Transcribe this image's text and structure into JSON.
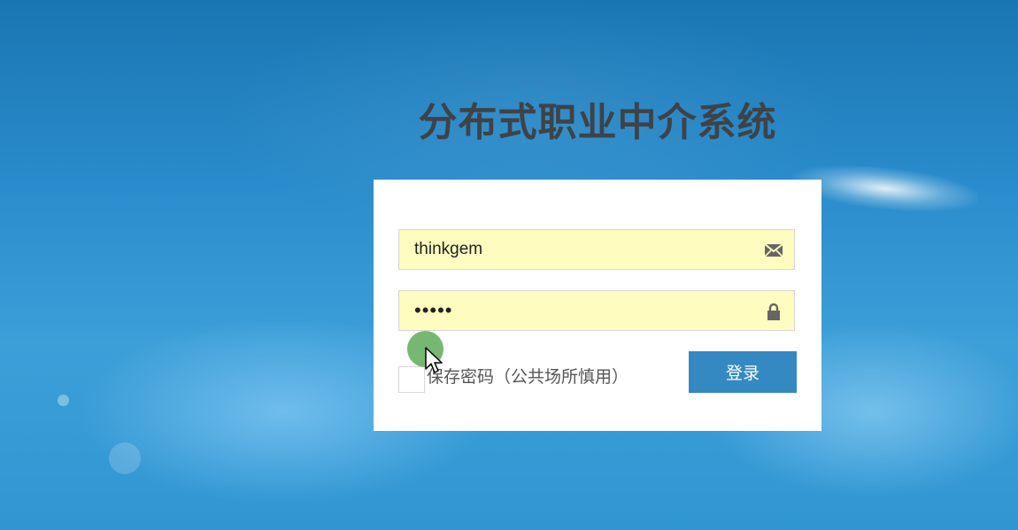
{
  "page": {
    "title": "分布式职业中介系统"
  },
  "login_form": {
    "username": {
      "value": "thinkgem",
      "icon": "envelope-icon"
    },
    "password": {
      "value": "•••••",
      "icon": "lock-icon"
    },
    "remember_label": "保存密码（公共场所慎用）",
    "remember_checked": false,
    "submit_label": "登录"
  },
  "colors": {
    "background": "#2a8ccc",
    "title": "#3f4246",
    "field_background": "#fefcbf",
    "button": "#3489c2",
    "click_indicator": "#6ab266"
  }
}
